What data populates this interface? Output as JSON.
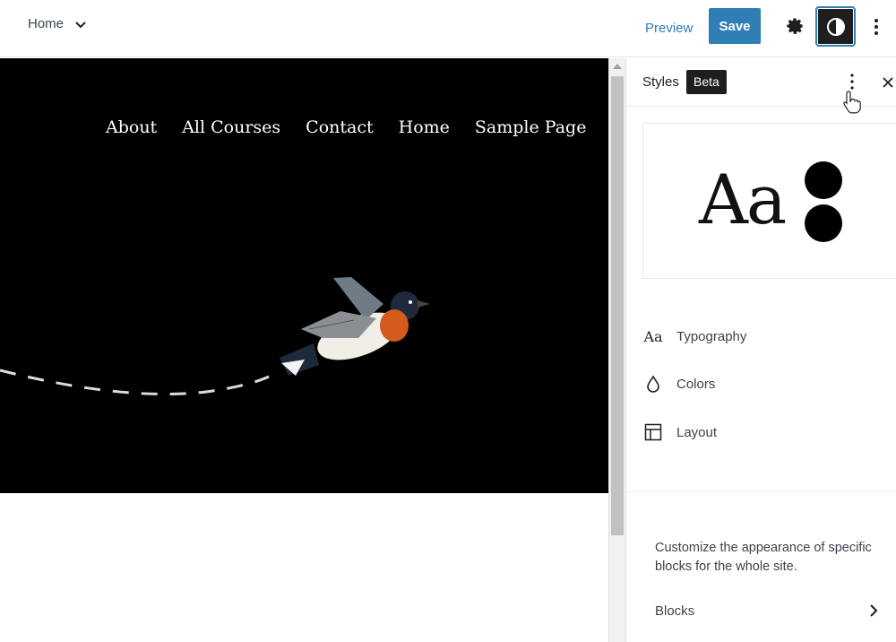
{
  "header": {
    "document_title": "Home",
    "preview_label": "Preview",
    "save_label": "Save",
    "accent_color": "#2f7fb6"
  },
  "canvas": {
    "nav_items": [
      "About",
      "All Courses",
      "Contact",
      "Home",
      "Sample Page"
    ],
    "hero_background": "#000000"
  },
  "sidebar": {
    "title": "Styles",
    "badge": "Beta",
    "preview_text": "Aa",
    "menu": [
      {
        "icon": "typography-icon",
        "icon_text": "Aa",
        "label": "Typography"
      },
      {
        "icon": "droplet-icon",
        "label": "Colors"
      },
      {
        "icon": "layout-icon",
        "label": "Layout"
      }
    ],
    "blocks_description": "Customize the appearance of specific blocks for the whole site.",
    "blocks_label": "Blocks"
  }
}
